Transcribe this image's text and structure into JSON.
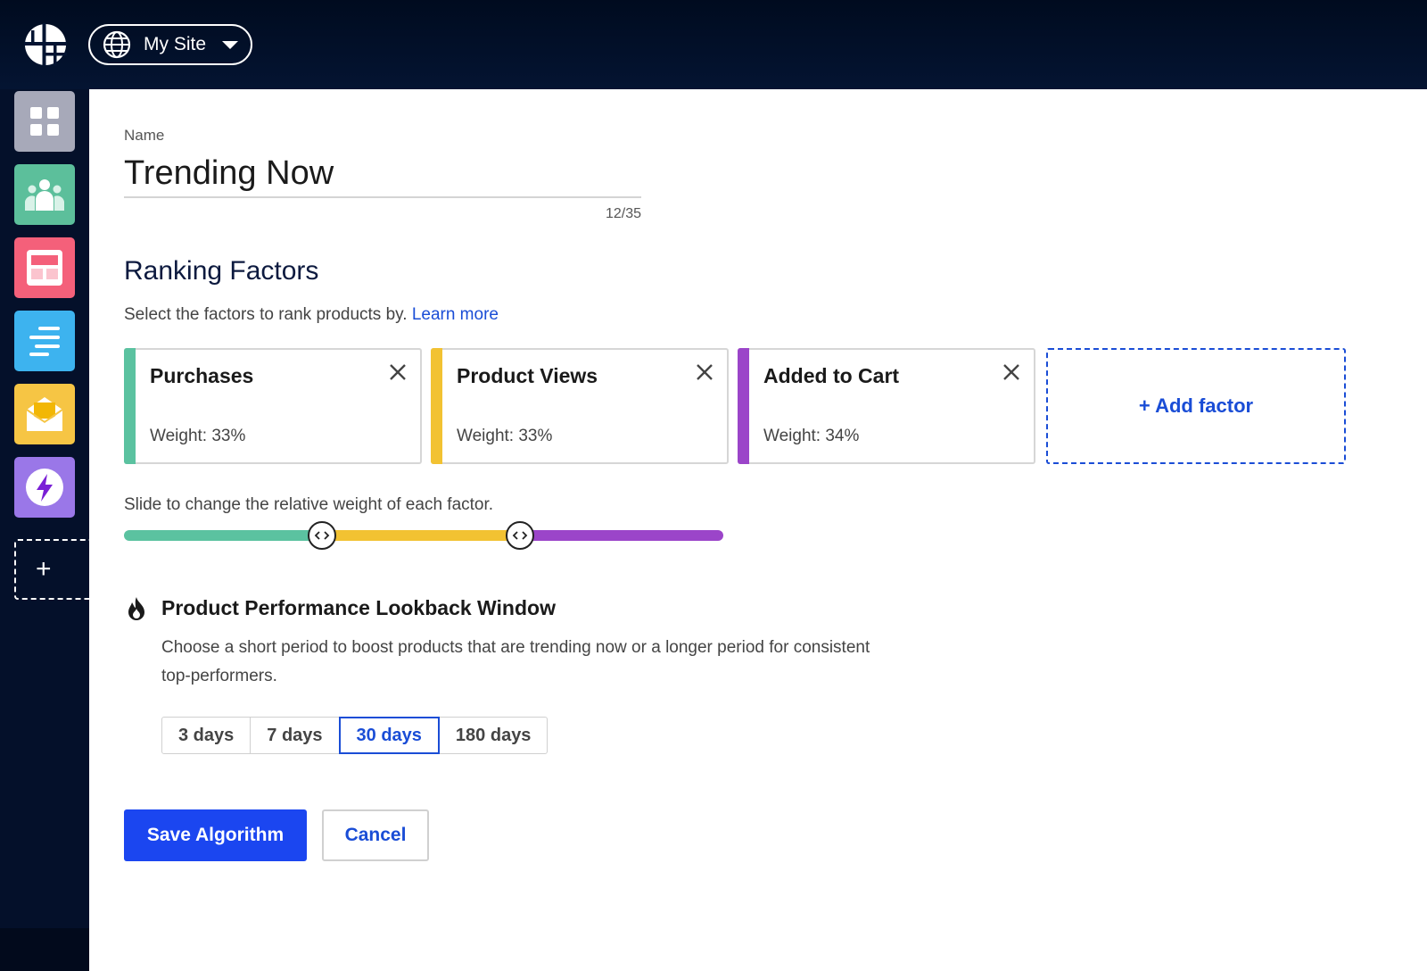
{
  "topbar": {
    "logo_icon": "grid-logo-icon",
    "site_selector": {
      "label": "My Site",
      "icon": "globe-icon"
    }
  },
  "sidebar": {
    "apps": [
      {
        "name": "dashboard",
        "icon": "grid-squares-icon",
        "color": "#a7a9b9"
      },
      {
        "name": "audiences",
        "icon": "people-group-icon",
        "color": "#5cbf9b"
      },
      {
        "name": "layouts",
        "icon": "layout-icon",
        "color": "#f4607a"
      },
      {
        "name": "content",
        "icon": "text-lines-icon",
        "color": "#3db3ef"
      },
      {
        "name": "email",
        "icon": "envelope-icon",
        "color": "#f6c544"
      },
      {
        "name": "automations",
        "icon": "lightning-icon",
        "color": "#9a77e8"
      }
    ],
    "add_label": "+"
  },
  "form": {
    "name_label": "Name",
    "name_value": "Trending Now",
    "char_count": "12/35"
  },
  "ranking": {
    "title": "Ranking Factors",
    "description": "Select the factors to rank products by.",
    "learn_more": "Learn more",
    "factors": [
      {
        "name": "Purchases",
        "weight": "Weight: 33%",
        "color": "#5bc2a0"
      },
      {
        "name": "Product Views",
        "weight": "Weight: 33%",
        "color": "#f2c232"
      },
      {
        "name": "Added to Cart",
        "weight": "Weight: 34%",
        "color": "#9b45c9"
      }
    ],
    "add_factor": "+ Add factor",
    "slider_description": "Slide to change the relative weight of each factor.",
    "slider_weights": [
      0.33,
      0.33,
      0.34
    ]
  },
  "lookback": {
    "title": "Product Performance Lookback Window",
    "description": "Choose a short period to boost products that are trending now or a longer period for consistent top-performers.",
    "options": [
      "3 days",
      "7 days",
      "30 days",
      "180 days"
    ],
    "selected": "30 days"
  },
  "actions": {
    "save": "Save Algorithm",
    "cancel": "Cancel"
  },
  "colors": {
    "accent": "#1b46f0",
    "link": "#1a4dd6",
    "navy": "#04102a"
  }
}
